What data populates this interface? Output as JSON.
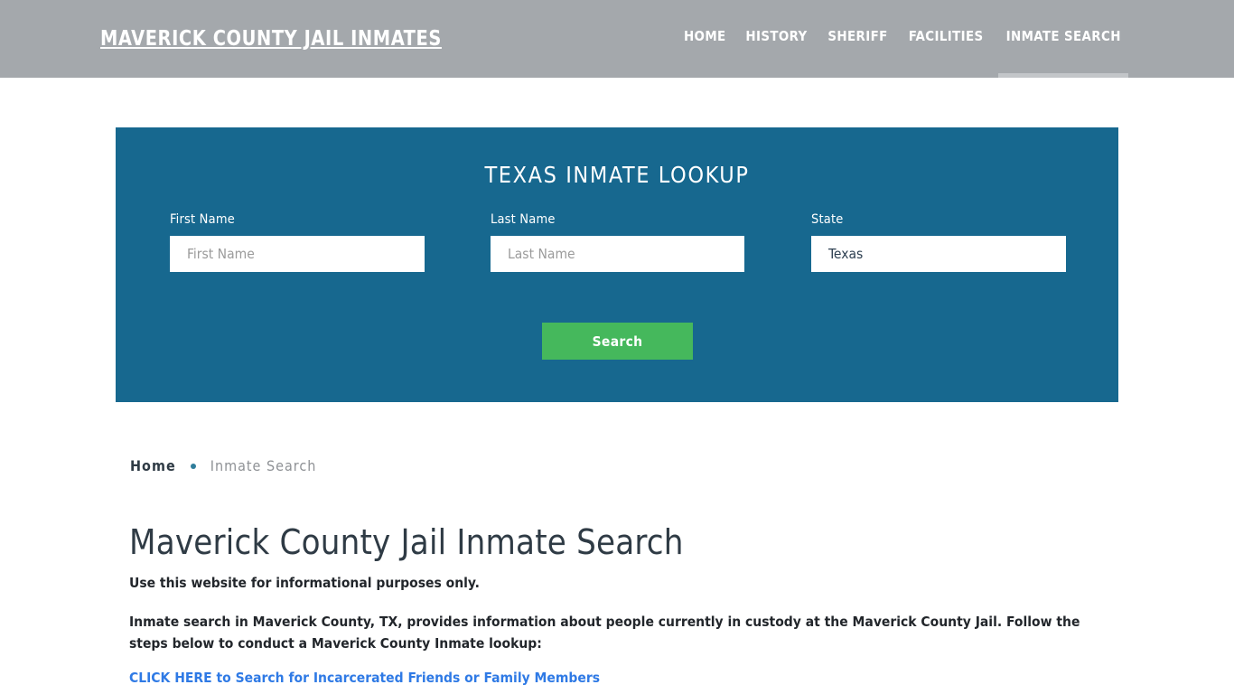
{
  "header": {
    "site_title": "MAVERICK COUNTY JAIL INMATES",
    "nav": [
      {
        "label": "HOME",
        "active": false
      },
      {
        "label": "HISTORY",
        "active": false
      },
      {
        "label": "SHERIFF",
        "active": false
      },
      {
        "label": "FACILITIES",
        "active": false
      },
      {
        "label": "INMATE SEARCH",
        "active": true
      }
    ]
  },
  "lookup": {
    "heading": "TEXAS INMATE LOOKUP",
    "first_name": {
      "label": "First Name",
      "placeholder": "First Name",
      "value": ""
    },
    "last_name": {
      "label": "Last Name",
      "placeholder": "Last Name",
      "value": ""
    },
    "state": {
      "label": "State",
      "selected": "Texas",
      "options": [
        "Texas"
      ]
    },
    "search_button": "Search"
  },
  "breadcrumb": {
    "home": "Home",
    "current": "Inmate Search"
  },
  "content": {
    "page_title": "Maverick County Jail Inmate Search",
    "intro_note": "Use this website for informational purposes only.",
    "paragraph": "Inmate search in Maverick County, TX, provides information about people currently in custody at the Maverick County Jail. Follow the steps below to conduct a Maverick County Inmate lookup:",
    "cta_link": "CLICK HERE to Search for Incarcerated Friends or Family Members"
  },
  "colors": {
    "header_gray": "#a4a8ac",
    "panel_blue": "#17688f",
    "button_green": "#45b85c",
    "link_blue": "#2f7ae5",
    "accent_bullet": "#2f7d9b"
  }
}
